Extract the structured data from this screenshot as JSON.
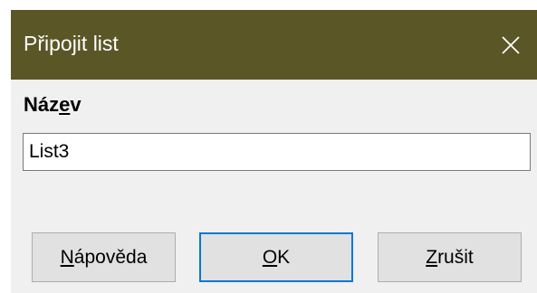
{
  "dialog": {
    "title": "Připojit list",
    "close_icon": "close-icon",
    "colors": {
      "titlebar": "#5b5626",
      "background": "#f0f0f0",
      "focus_border": "#0078d7"
    }
  },
  "name_field": {
    "label_before": "Náz",
    "label_mnemonic": "e",
    "label_after": "v",
    "value": "List3"
  },
  "buttons": {
    "help": {
      "mnemonic": "N",
      "rest": "ápověda"
    },
    "ok": {
      "mnemonic": "O",
      "rest": "K"
    },
    "cancel": {
      "mnemonic": "Z",
      "rest": "rušit"
    }
  }
}
